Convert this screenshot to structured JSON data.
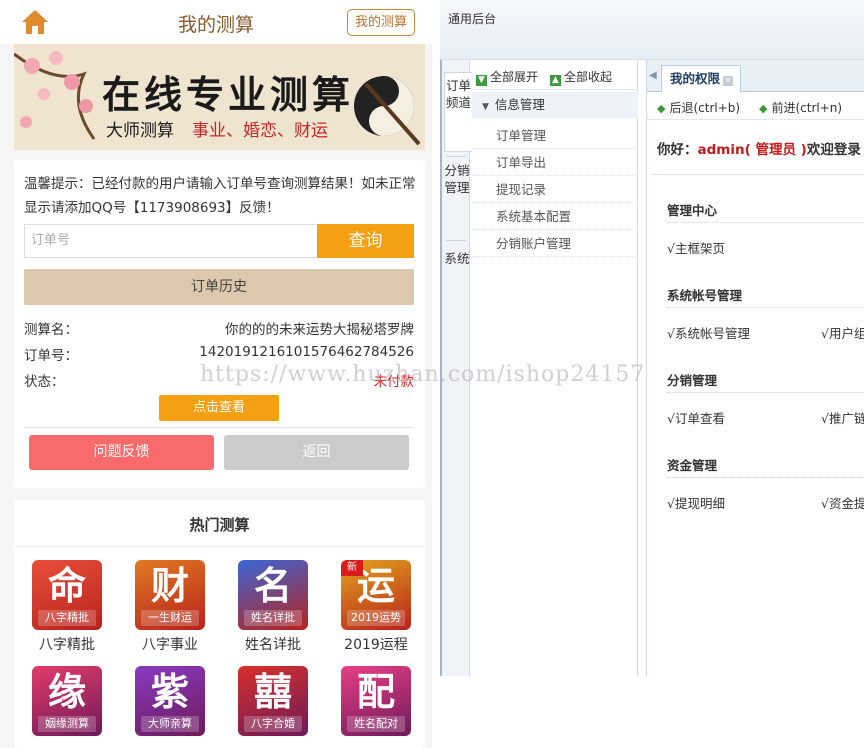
{
  "mobile": {
    "title": "我的测算",
    "my_button": "我的测算",
    "banner": {
      "title": "在线专业测算",
      "sub1": "大师测算",
      "sub2": "事业、婚恋、财运"
    },
    "tip": "温馨提示：已经付款的用户请输入订单号查询测算结果！如未正常显示请添加QQ号【1173908693】反馈！",
    "order_placeholder": "订单号",
    "query_button": "查询",
    "history_button": "订单历史",
    "rows": [
      {
        "key": "测算名：",
        "value": "你的的的未来运势大揭秘塔罗牌"
      },
      {
        "key": "订单号：",
        "value": "14201912161015764627845​26"
      },
      {
        "key": "状态：",
        "value": "未付款"
      }
    ],
    "view_button": "点击查看",
    "feedback_button": "问题反馈",
    "back_button": "返回",
    "hot_title": "热门测算",
    "hot_items": [
      {
        "glyph": "命",
        "sub": "八字精批",
        "label": "八字精批",
        "color": "#e8503a",
        "tag": ""
      },
      {
        "glyph": "财",
        "sub": "一生财运",
        "label": "八字事业",
        "color": "#e07a22",
        "tag": ""
      },
      {
        "glyph": "名",
        "sub": "姓名详批",
        "label": "姓名详批",
        "color": "#3b66d6",
        "tag": ""
      },
      {
        "glyph": "运",
        "sub": "2019运势",
        "label": "2019运程",
        "color": "#e2a21d",
        "tag": "新"
      },
      {
        "glyph": "缘",
        "sub": "姻缘测算",
        "label": "",
        "color": "#e33b6a",
        "tag": ""
      },
      {
        "glyph": "紫",
        "sub": "大师亲算",
        "label": "",
        "color": "#8a3bc2",
        "tag": ""
      },
      {
        "glyph": "囍",
        "sub": "八字合婚",
        "label": "",
        "color": "#d8302a",
        "tag": ""
      },
      {
        "glyph": "配",
        "sub": "姓名配对",
        "label": "",
        "color": "#e83f86",
        "tag": ""
      }
    ]
  },
  "admin": {
    "top_title": "通用后台",
    "vtabs": [
      "订单频道",
      "分销管理",
      "系统"
    ],
    "expand_all": "全部展开",
    "collapse_all": "全部收起",
    "tree_group": "信息管理",
    "tree_items": [
      "订单管理",
      "订单导出",
      "提现记录",
      "系统基本配置",
      "分销账户管理"
    ],
    "tab_label": "我的权限",
    "back_btn": "后退(ctrl+b)",
    "forward_btn": "前进(ctrl+n)",
    "welcome_prefix": "你好：",
    "welcome_user": "admin( 管理员 )",
    "welcome_suffix": "欢迎登录",
    "sections": [
      {
        "title": "管理中心",
        "links": [
          "√主框架页"
        ]
      },
      {
        "title": "系统帐号管理",
        "links": [
          "√系统帐号管理",
          "√用户组"
        ]
      },
      {
        "title": "分销管理",
        "links": [
          "√订单查看",
          "√推广链"
        ]
      },
      {
        "title": "资金管理",
        "links": [
          "√提现明细",
          "√资金提"
        ]
      }
    ]
  },
  "watermark": "https://www.huzhan.com/ishop24157"
}
